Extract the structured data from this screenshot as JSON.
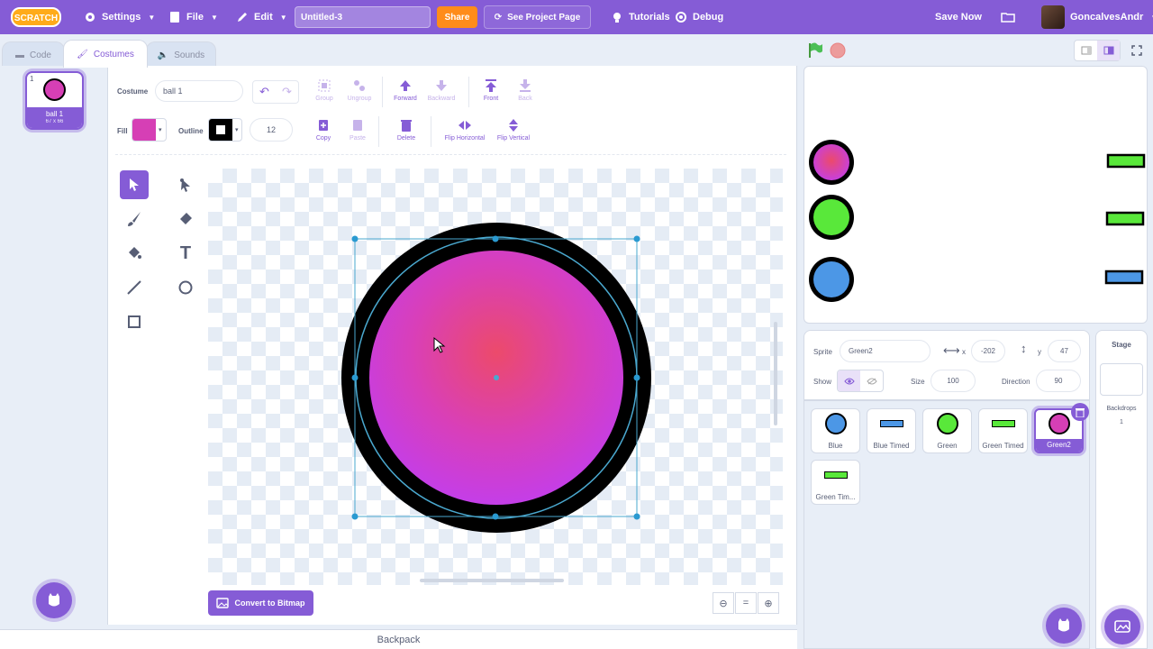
{
  "menubar": {
    "logo": "SCRATCH",
    "settings": "Settings",
    "file": "File",
    "edit": "Edit",
    "project_title": "Untitled-3",
    "share": "Share",
    "see_project": "See Project Page",
    "tutorials": "Tutorials",
    "debug": "Debug",
    "save_now": "Save Now",
    "username": "GoncalvesAndr"
  },
  "tabs": {
    "code": "Code",
    "costumes": "Costumes",
    "sounds": "Sounds"
  },
  "costume_list": [
    {
      "number": "1",
      "name": "ball 1",
      "size": "67 x 66"
    }
  ],
  "editor": {
    "costume_label": "Costume",
    "costume_name": "ball 1",
    "fill_label": "Fill",
    "fill_color": "#d63fb5",
    "outline_label": "Outline",
    "outline_color": "#000000",
    "outline_width": "12",
    "group": "Group",
    "ungroup": "Ungroup",
    "forward": "Forward",
    "backward": "Backward",
    "front": "Front",
    "back": "Back",
    "copy": "Copy",
    "paste": "Paste",
    "delete": "Delete",
    "flip_h": "Flip Horizontal",
    "flip_v": "Flip Vertical",
    "convert": "Convert to Bitmap",
    "zoom_reset": "="
  },
  "backpack": "Backpack",
  "sprite_info": {
    "sprite_label": "Sprite",
    "sprite_name": "Green2",
    "x_label": "x",
    "x": "-202",
    "y_label": "y",
    "y": "47",
    "show_label": "Show",
    "size_label": "Size",
    "size": "100",
    "direction_label": "Direction",
    "direction": "90"
  },
  "sprites": [
    {
      "name": "Blue",
      "kind": "circle",
      "color": "#4c97e6"
    },
    {
      "name": "Blue Timed",
      "kind": "rect",
      "color": "#4c97e6"
    },
    {
      "name": "Green",
      "kind": "circle",
      "color": "#59e83a"
    },
    {
      "name": "Green Timed",
      "kind": "rect",
      "color": "#59e83a"
    },
    {
      "name": "Green2",
      "kind": "circle",
      "color": "#d63fb5",
      "selected": true
    },
    {
      "name": "Green Tim...",
      "kind": "rect",
      "color": "#59e83a"
    }
  ],
  "stage_pane": {
    "title": "Stage",
    "backdrops_label": "Backdrops",
    "backdrops_count": "1"
  },
  "colors": {
    "accent": "#855cd6",
    "share": "#ff8c1a",
    "ball_pink": "#d63fb5",
    "ball_green": "#59e83a",
    "ball_blue": "#4c97e6"
  }
}
